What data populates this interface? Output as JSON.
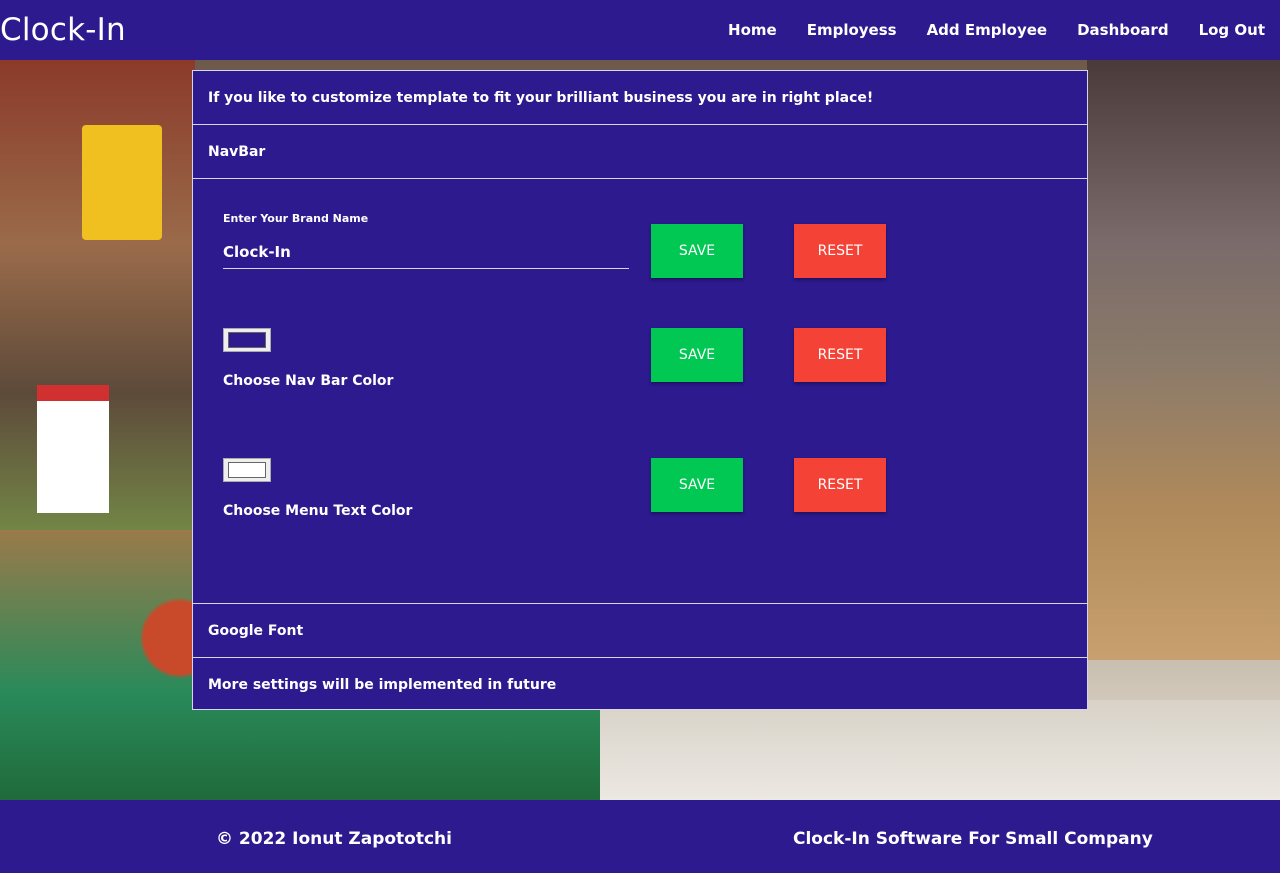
{
  "navbar": {
    "brand": "Clock-In",
    "links": [
      "Home",
      "Employess",
      "Add Employee",
      "Dashboard",
      "Log Out"
    ],
    "color": "#2c1a8e"
  },
  "panel": {
    "intro": "If you like to customize template to fit your brilliant business you are in right place!",
    "navbar_section": "NavBar",
    "brand_field": {
      "label": "Enter Your Brand Name",
      "value": "Clock-In"
    },
    "nav_color_label": "Choose Nav Bar Color",
    "menu_text_color_label": "Choose Menu Text Color",
    "nav_color_value": "#2c1a8e",
    "menu_text_color_value": "#ffffff",
    "save_label": "SAVE",
    "reset_label": "RESET",
    "google_font_section": "Google Font",
    "more_settings": "More settings will be implemented in future"
  },
  "colors": {
    "save": "#00c853",
    "reset": "#f44336"
  },
  "footer": {
    "copyright": "© 2022 Ionut Zapototchi",
    "tagline": "Clock-In Software For Small Company"
  }
}
